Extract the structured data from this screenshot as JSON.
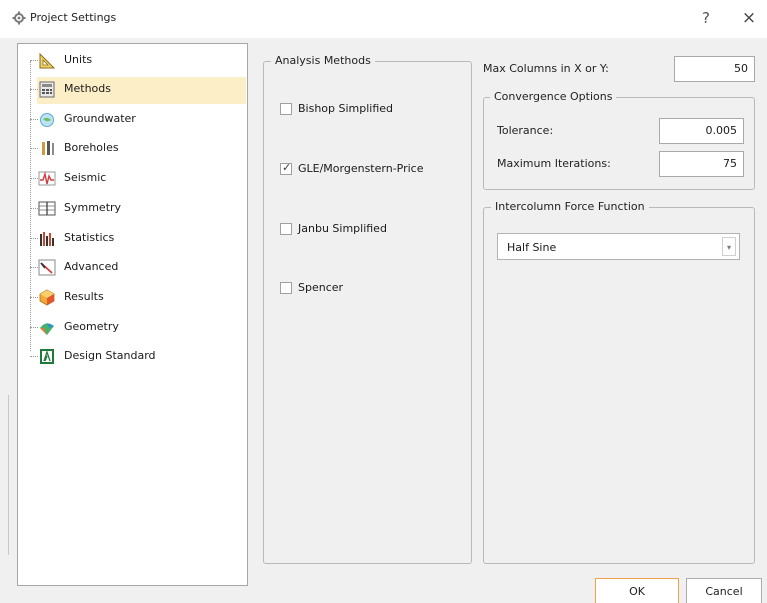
{
  "window": {
    "title": "Project Settings",
    "help_label": "?",
    "close_label": "×"
  },
  "tree": {
    "items": [
      {
        "label": "Units",
        "icon": "units-icon"
      },
      {
        "label": "Methods",
        "icon": "methods-icon",
        "selected": true
      },
      {
        "label": "Groundwater",
        "icon": "groundwater-icon"
      },
      {
        "label": "Boreholes",
        "icon": "boreholes-icon"
      },
      {
        "label": "Seismic",
        "icon": "seismic-icon"
      },
      {
        "label": "Symmetry",
        "icon": "symmetry-icon"
      },
      {
        "label": "Statistics",
        "icon": "statistics-icon"
      },
      {
        "label": "Advanced",
        "icon": "advanced-icon"
      },
      {
        "label": "Results",
        "icon": "results-icon"
      },
      {
        "label": "Geometry",
        "icon": "geometry-icon"
      },
      {
        "label": "Design Standard",
        "icon": "design-standard-icon"
      }
    ]
  },
  "analysis_methods": {
    "legend": "Analysis Methods",
    "options": [
      {
        "label": "Bishop Simplified",
        "checked": false
      },
      {
        "label": "GLE/Morgenstern-Price",
        "checked": true
      },
      {
        "label": "Janbu Simplified",
        "checked": false
      },
      {
        "label": "Spencer",
        "checked": false
      }
    ]
  },
  "columns": {
    "label": "Max Columns in X or Y:",
    "value": "50"
  },
  "convergence": {
    "legend": "Convergence Options",
    "tolerance_label": "Tolerance:",
    "tolerance_value": "0.005",
    "iterations_label": "Maximum Iterations:",
    "iterations_value": "75"
  },
  "intercolumn": {
    "legend": "Intercolumn Force Function",
    "selected": "Half Sine"
  },
  "buttons": {
    "ok": "OK",
    "cancel": "Cancel"
  },
  "colors": {
    "selection": "#fcefc8",
    "default_button_border": "#f0a24a"
  }
}
